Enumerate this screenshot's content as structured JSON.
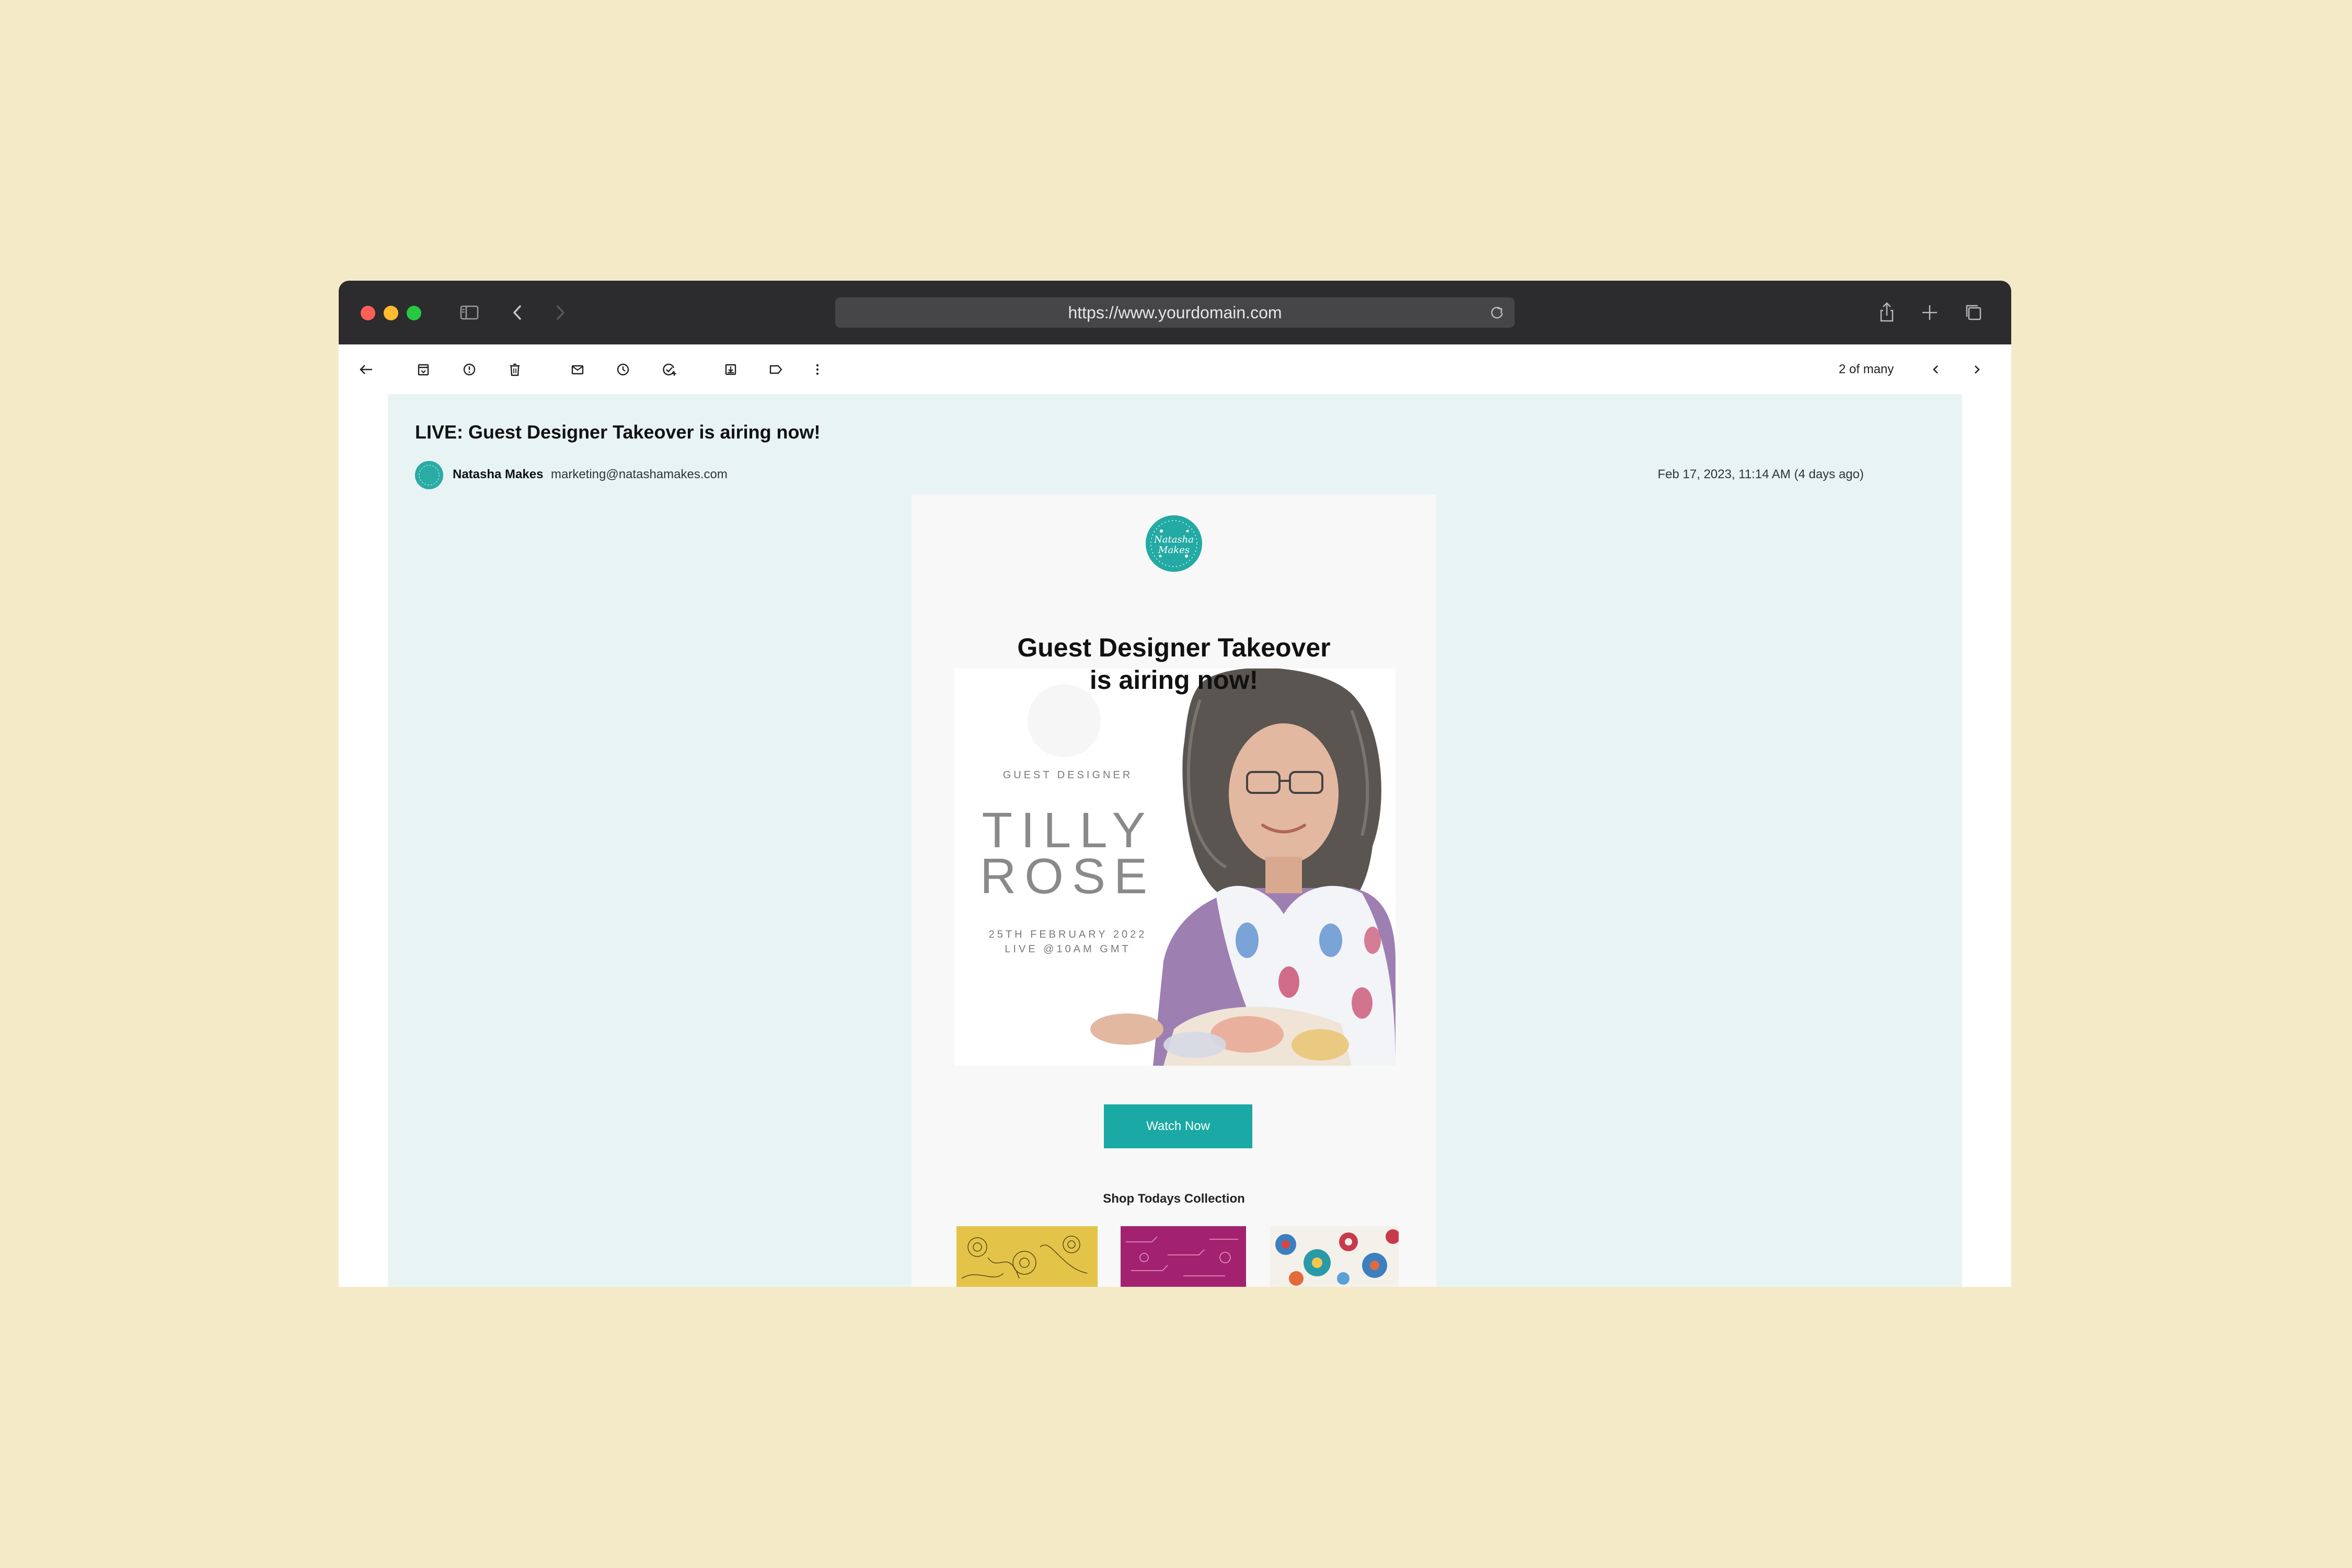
{
  "browser": {
    "url": "https://www.yourdomain.com",
    "icons": [
      "sidebar-icon",
      "back-arrow-icon",
      "forward-arrow-icon",
      "reload-icon",
      "share-icon",
      "new-tab-plus-icon",
      "tabs-overview-icon"
    ]
  },
  "mail_toolbar": {
    "icons": [
      "back-icon",
      "archive-icon",
      "report-spam-icon",
      "delete-icon",
      "mark-unread-icon",
      "snooze-icon",
      "add-task-icon",
      "move-to-icon",
      "label-icon",
      "more-icon"
    ],
    "counter": "2 of many"
  },
  "message": {
    "subject": "LIVE: Guest Designer Takeover is airing now!",
    "sender_name": "Natasha Makes",
    "sender_email": "marketing@natashamakes.com",
    "date": "Feb 17, 2023, 11:14 AM (4 days ago)"
  },
  "email_body": {
    "logo_text": "Natasha Makes",
    "headline_line1": "Guest Designer Takeover",
    "headline_line2": "is airing now!",
    "hero": {
      "guest_label": "GUEST DESIGNER",
      "name_line1": "TILLY",
      "name_line2": "ROSE",
      "date_line": "25TH FEBRUARY 2022",
      "live_line": "LIVE @10AM GMT"
    },
    "cta_label": "Watch Now",
    "shop_title": "Shop Todays Collection"
  },
  "colors": {
    "background": "#f5eac8",
    "browser_chrome": "#2c2c2e",
    "pane": "#e8f4f4",
    "accent_teal": "#1aa9a4",
    "swatch_yellow": "#e3c449",
    "swatch_magenta": "#a3226f"
  }
}
